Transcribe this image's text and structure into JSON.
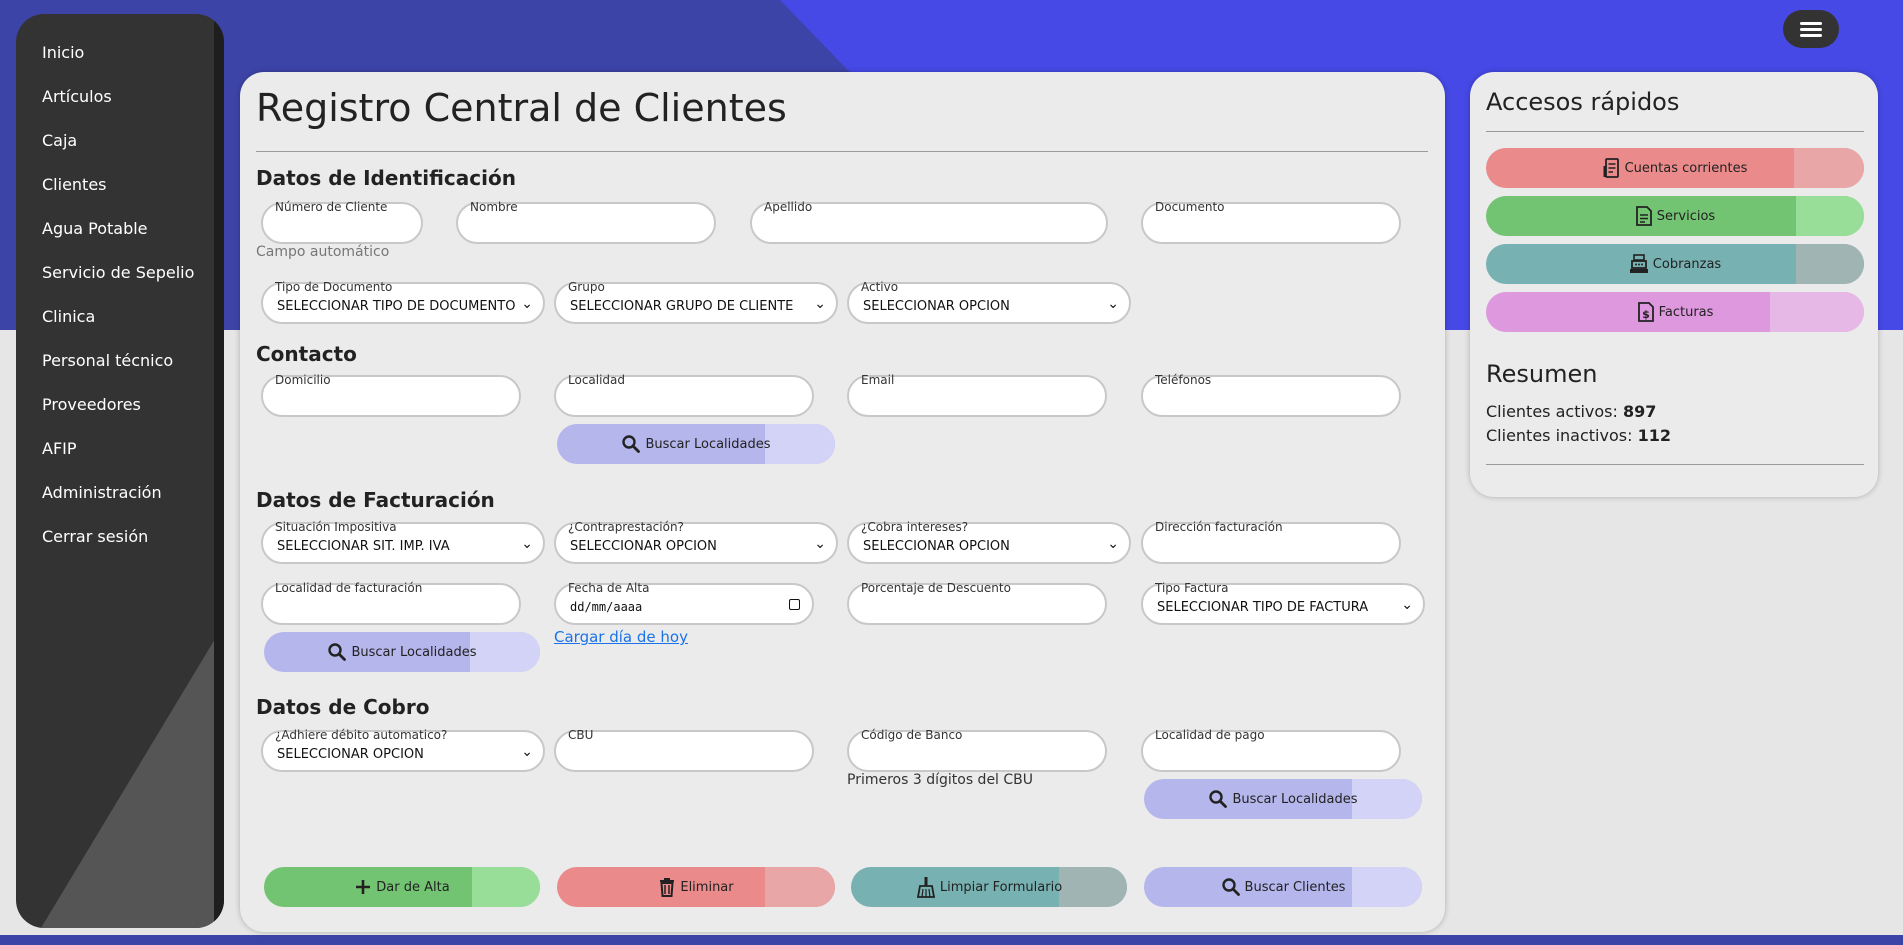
{
  "sidebar": {
    "items": [
      {
        "label": "Inicio"
      },
      {
        "label": "Artículos"
      },
      {
        "label": "Caja"
      },
      {
        "label": "Clientes"
      },
      {
        "label": "Agua Potable"
      },
      {
        "label": "Servicio de Sepelio"
      },
      {
        "label": "Clinica"
      },
      {
        "label": "Personal técnico"
      },
      {
        "label": "Proveedores"
      },
      {
        "label": "AFIP"
      },
      {
        "label": "Administración"
      },
      {
        "label": "Cerrar sesión"
      }
    ]
  },
  "main": {
    "title": "Registro Central de Clientes",
    "identificacion": {
      "title": "Datos de Identificación",
      "numero_cliente": {
        "label": "Número de Cliente",
        "value": ""
      },
      "numero_hint": "Campo automático",
      "nombre": {
        "label": "Nombre",
        "value": ""
      },
      "apellido": {
        "label": "Apellido",
        "value": ""
      },
      "documento": {
        "label": "Documento",
        "value": ""
      },
      "tipo_documento": {
        "label": "Tipo de Documento",
        "value": "SELECCIONAR TIPO DE DOCUMENTO"
      },
      "grupo": {
        "label": "Grupo",
        "value": "SELECCIONAR GRUPO DE CLIENTE"
      },
      "activo": {
        "label": "Activo",
        "value": "SELECCIONAR OPCIÓN"
      }
    },
    "contacto": {
      "title": "Contacto",
      "domicilio": {
        "label": "Domicilio",
        "value": ""
      },
      "localidad": {
        "label": "Localidad",
        "value": ""
      },
      "email": {
        "label": "Email",
        "value": ""
      },
      "telefonos": {
        "label": "Teléfonos",
        "value": ""
      },
      "buscar_localidades": "Buscar Localidades"
    },
    "facturacion": {
      "title": "Datos de Facturación",
      "situacion": {
        "label": "Situación Impositiva",
        "value": "SELECCIONAR SIT. IMP. IVA"
      },
      "contraprestacion": {
        "label": "¿Contraprestación?",
        "value": "SELECCIONAR OPCIÓN"
      },
      "cobra_intereses": {
        "label": "¿Cobra intereses?",
        "value": "SELECCIONAR OPCIÓN"
      },
      "direccion": {
        "label": "Dirección facturación",
        "value": ""
      },
      "localidad": {
        "label": "Localidad de facturación",
        "value": ""
      },
      "fecha_alta": {
        "label": "Fecha de Alta",
        "value": "dd/mm/aaaa"
      },
      "porcentaje": {
        "label": "Porcentaje de Descuento",
        "value": ""
      },
      "tipo_factura": {
        "label": "Tipo Factura",
        "value": "SELECCIONAR TIPO DE FACTURA"
      },
      "buscar_localidades": "Buscar Localidades",
      "cargar_hoy": "Cargar día de hoy"
    },
    "cobro": {
      "title": "Datos de Cobro",
      "debito": {
        "label": "¿Adhiere débito automatico?",
        "value": "SELECCIONAR OPCIÓN"
      },
      "cbu": {
        "label": "CBU",
        "value": ""
      },
      "codigo_banco": {
        "label": "Código de Banco",
        "value": ""
      },
      "codigo_hint": "Primeros 3 dígitos del CBU",
      "localidad_pago": {
        "label": "Localidad de pago",
        "value": ""
      },
      "buscar_localidades": "Buscar Localidades"
    },
    "actions": {
      "alta": "Dar de Alta",
      "eliminar": "Eliminar",
      "limpiar": "Limpiar Formulario",
      "buscar": "Buscar Clientes"
    }
  },
  "quick": {
    "title": "Accesos rápidos",
    "items": [
      {
        "label": "Cuentas corrientes",
        "icon": "receipt-icon"
      },
      {
        "label": "Servicios",
        "icon": "document-icon"
      },
      {
        "label": "Cobranzas",
        "icon": "cash-register-icon"
      },
      {
        "label": "Facturas",
        "icon": "invoice-dollar-icon"
      }
    ]
  },
  "resumen": {
    "title": "Resumen",
    "activos_label": "Clientes activos:",
    "activos_value": "897",
    "inactivos_label": "Clientes inactivos:",
    "inactivos_value": "112"
  },
  "colors": {
    "header_blue": "#4649e6",
    "header_dark": "#3d44a8",
    "sidebar": "#333333",
    "btn_blue": "#b4b6ec",
    "btn_green": "#72c472",
    "btn_red": "#eb8a8a",
    "btn_teal": "#78b1b1",
    "btn_pink": "#de98de"
  }
}
